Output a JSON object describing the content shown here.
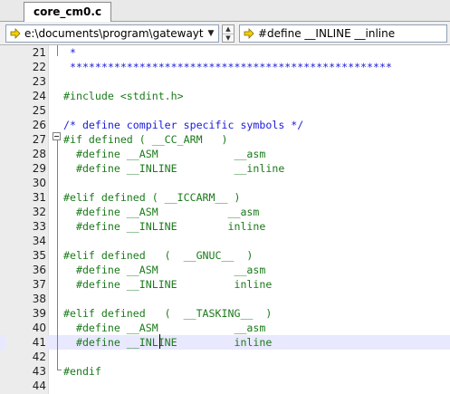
{
  "tab": {
    "label": "core_cm0.c"
  },
  "toolbar": {
    "path_value": "e:\\documents\\program\\gatewayt",
    "symbol_value": "#define __INLINE          __inline"
  },
  "editor": {
    "lines": [
      {
        "num": "21",
        "text": " *"
      },
      {
        "num": "22",
        "text": " ***************************************************"
      },
      {
        "num": "23",
        "text": ""
      },
      {
        "num": "24",
        "text": "#include <stdint.h>"
      },
      {
        "num": "25",
        "text": ""
      },
      {
        "num": "26",
        "text": "/* define compiler specific symbols */"
      },
      {
        "num": "27",
        "text": "#if defined ( __CC_ARM   )"
      },
      {
        "num": "28",
        "text": "  #define __ASM            __asm"
      },
      {
        "num": "29",
        "text": "  #define __INLINE         __inline"
      },
      {
        "num": "30",
        "text": ""
      },
      {
        "num": "31",
        "text": "#elif defined ( __ICCARM__ )"
      },
      {
        "num": "32",
        "text": "  #define __ASM           __asm"
      },
      {
        "num": "33",
        "text": "  #define __INLINE        inline"
      },
      {
        "num": "34",
        "text": ""
      },
      {
        "num": "35",
        "text": "#elif defined   (  __GNUC__  )"
      },
      {
        "num": "36",
        "text": "  #define __ASM            __asm"
      },
      {
        "num": "37",
        "text": "  #define __INLINE         inline"
      },
      {
        "num": "38",
        "text": ""
      },
      {
        "num": "39",
        "text": "#elif defined   (  __TASKING__  )"
      },
      {
        "num": "40",
        "text": "  #define __ASM            __asm"
      },
      {
        "num": "41",
        "text": "  #define __INLINE         inline"
      },
      {
        "num": "42",
        "text": ""
      },
      {
        "num": "43",
        "text": "#endif"
      },
      {
        "num": "44",
        "text": ""
      }
    ]
  },
  "colors": {
    "code_green": "#1b7a1b",
    "comment_blue": "#1a1ae0",
    "current_line": "#e8e8ff",
    "toolbar_arrow": "#e8c000"
  },
  "icons": [
    "goto-arrow-icon",
    "dropdown-arrow-icon",
    "spin-up-icon",
    "spin-down-icon",
    "fold-collapse-icon"
  ]
}
